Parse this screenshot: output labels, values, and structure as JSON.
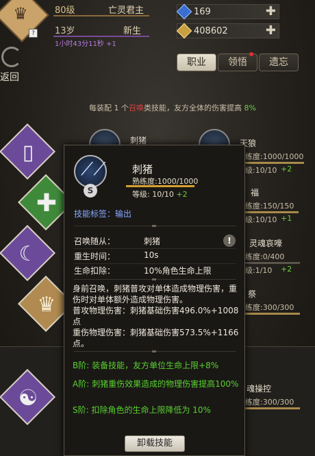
{
  "player": {
    "level": "80级",
    "title": "亡灵君主",
    "age": "13岁",
    "stage": "新生",
    "timer": "1小时43分11秒 +1"
  },
  "resources": [
    {
      "icon": "blue-gem-icon",
      "value": "169"
    },
    {
      "icon": "gold-coin-icon",
      "value": "408602"
    }
  ],
  "back_label": "返回",
  "tabs": [
    {
      "label": "职业",
      "active": true
    },
    {
      "label": "领悟",
      "active": false
    },
    {
      "label": "遗忘",
      "active": false
    }
  ],
  "info": {
    "prefix": "每装配 1 个",
    "highlight": "召唤",
    "middle": "类技能，友方全体的伤害提高",
    "value": "8%"
  },
  "bg_skills": [
    {
      "name": "刺猪"
    },
    {
      "name": "天狼",
      "prof": "练度:1000/1000",
      "lvl": "级:10/10",
      "plus": "+2"
    },
    {
      "name": "福",
      "prof": "练度:150/150",
      "lvl": "级:10/10",
      "plus": "+1"
    },
    {
      "name": "灵魂哀嚎",
      "prof": "练度:0/400",
      "lvl": "级:1/10",
      "plus": "+2"
    },
    {
      "name": "祭",
      "prof": "练度:300/300"
    },
    {
      "name": "魂操控",
      "prof": "练度:300/300"
    }
  ],
  "popup": {
    "name": "刺猪",
    "proficiency": "熟练度:1000/1000",
    "level": "等级: 10/10",
    "level_plus": "+2",
    "tag": "技能标签：输出",
    "shield_letter": "S",
    "attrs": [
      {
        "key": "召唤随从：",
        "value": "刺猪"
      },
      {
        "key": "重生时间：",
        "value": "10s"
      },
      {
        "key": "生命扣除：",
        "value": "10%角色生命上限"
      }
    ],
    "description": "身前召唤，刺猪普攻对单体造成物理伤害，重伤时对单体额外造成物理伤害。\n普攻物理伤害：刺猪基础伤害496.0%+1008点\n重伤物理伤害：刺猪基础伤害573.5%+1166点。",
    "tiers": [
      "B阶: 装备技能，友方单位生命上限+8%",
      "A阶: 刺猪重伤效果造成的物理伤害提高100%",
      "S阶: 扣除角色的生命上限降低为 10%"
    ],
    "unload_label": "卸载技能"
  },
  "colors": {
    "purple": "#6b4a9a",
    "green": "#3f8a3a",
    "gold": "#b08a50"
  }
}
